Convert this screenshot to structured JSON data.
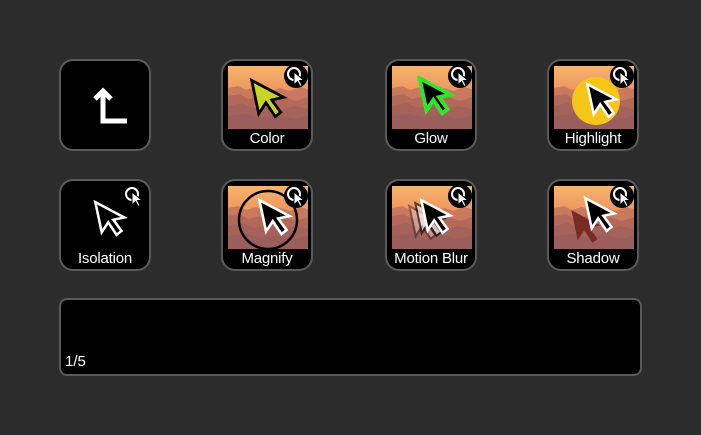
{
  "keys": {
    "back": {
      "icon": "back-arrow-icon"
    },
    "color": {
      "label": "Color",
      "accent": "#c9d429"
    },
    "glow": {
      "label": "Glow",
      "accent": "#2ee62e"
    },
    "highlight": {
      "label": "Highlight",
      "accent": "#f5c518"
    },
    "isolation": {
      "label": "Isolation"
    },
    "magnify": {
      "label": "Magnify"
    },
    "motion_blur": {
      "label": "Motion Blur"
    },
    "shadow": {
      "label": "Shadow",
      "accent": "#7a2a22"
    }
  },
  "status": {
    "page": "1/5"
  },
  "colors": {
    "background": "#2c2c2c",
    "key_background": "#000000",
    "key_border": "#5a5a5a",
    "sky_top": "#f0b070",
    "sky_bottom": "#e88a5a",
    "canyon": "#a86650"
  }
}
